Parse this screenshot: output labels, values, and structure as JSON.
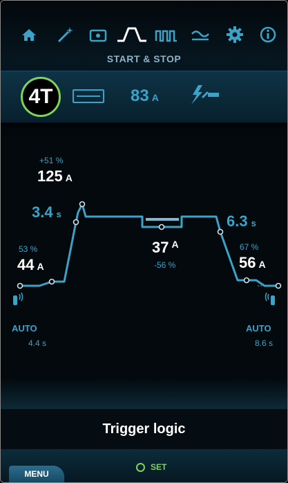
{
  "colors": {
    "accent": "#3ba2c8",
    "active": "#7fd35a",
    "background": "#03090d"
  },
  "nav": {
    "icons": [
      "home-icon",
      "wand-icon",
      "camera-icon",
      "start-stop-curve-icon",
      "pulse-icon",
      "wave-icon",
      "gear-icon",
      "info-icon"
    ],
    "active": "start-stop-curve-icon",
    "section_title": "START & STOP"
  },
  "mode": {
    "trigger_badge": "4T",
    "display_icon": "display-rect-icon",
    "current_value": "83",
    "current_unit": "A",
    "torch_icon": "torch-lightning-icon"
  },
  "graph": {
    "peak_percent": "+51 %",
    "peak_value": "125",
    "peak_unit": "A",
    "upslope_time": "3.4",
    "upslope_unit": "s",
    "downslope_time": "6.3",
    "downslope_unit": "s",
    "start_percent": "53 %",
    "start_value": "44",
    "start_unit": "A",
    "base_value": "37",
    "base_unit": "A",
    "base_percent": "-56 %",
    "end_percent": "67 %",
    "end_value": "56",
    "end_unit": "A",
    "preflow_label": "AUTO",
    "preflow_time": "4.4 s",
    "postflow_label": "AUTO",
    "postflow_time": "8.6 s"
  },
  "help": {
    "title": "Trigger logic"
  },
  "footer": {
    "menu_label": "MENU",
    "set_label": "SET"
  }
}
